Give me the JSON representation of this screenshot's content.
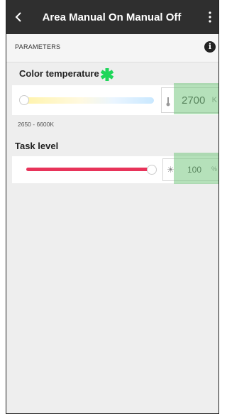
{
  "header": {
    "title": "Area Manual On Manual Off",
    "back_icon": "chevron-left-icon",
    "menu_icon": "more-vertical-icon"
  },
  "parameters": {
    "label": "PARAMETERS",
    "info_icon": "info-icon",
    "info_glyph": "i"
  },
  "color_temperature": {
    "label": "Color temperature",
    "annotation_icon": "green-star-icon",
    "value": "2700",
    "unit": "K",
    "range_text": "2650 - 6600K",
    "slider_fraction": 0.01,
    "icon": "thermometer-icon"
  },
  "task_level": {
    "label": "Task level",
    "value": "100",
    "unit": "%",
    "slider_fraction": 1.0,
    "icon": "sun-icon",
    "icon_glyph": "☀",
    "track_color": "#e8335a"
  },
  "colors": {
    "topbar": "#2f2f2f",
    "highlight": "#78c882",
    "star": "#1fd65a"
  }
}
